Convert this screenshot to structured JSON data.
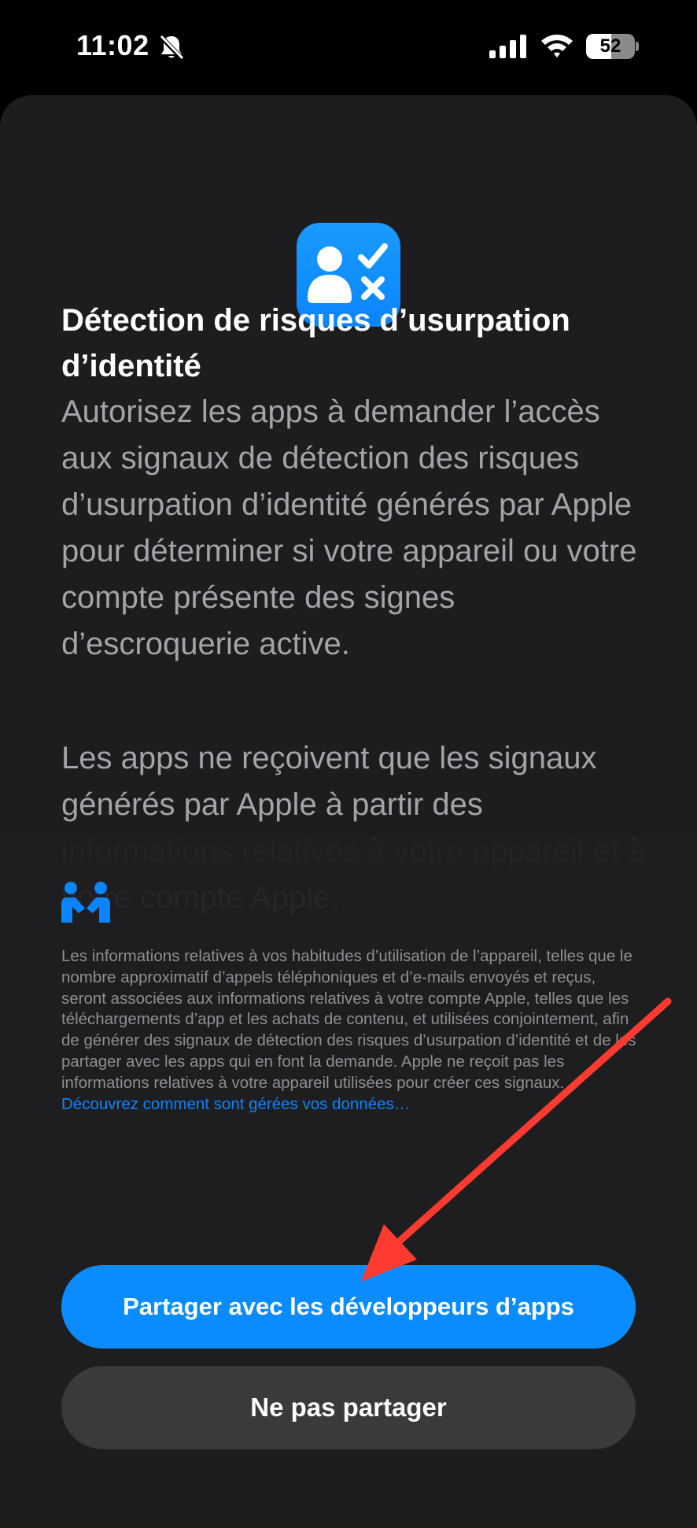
{
  "status_bar": {
    "time": "11:02",
    "battery_percent": "52",
    "icons": [
      "bell-slash-icon",
      "cellular-signal-icon",
      "wifi-icon",
      "battery-icon"
    ]
  },
  "sheet": {
    "app_icon": "person-check-x-icon",
    "title": "Détection de risques d’usurpation d’identité",
    "paragraph_1": "Autorisez les apps à demander l’accès aux signaux de détection des risques d’usurpation d’identité générés par Apple pour déterminer si votre appareil ou votre compte présente des signes d’escroquerie active.",
    "paragraph_2": "Les apps ne reçoivent que les signaux générés par Apple à partir des informations relatives à votre appareil et à votre compte Apple."
  },
  "privacy": {
    "icon": "privacy-handshake-icon",
    "text": "Les informations relatives à vos habitudes d’utilisation de l’appareil, telles que le nombre approximatif d’appels téléphoniques et d’e-mails envoyés et reçus, seront associées aux informations relatives à votre compte Apple, telles que les téléchargements d’app et les achats de contenu, et utilisées conjointement, afin de générer des signaux de détection des risques d’usurpation d’identité et de les partager avec les apps qui en font la demande. Apple ne reçoit pas les informations relatives à votre appareil utilisées pour créer ces signaux.",
    "link": "Découvrez comment sont gérées vos données…"
  },
  "buttons": {
    "share_label": "Partager avec les développeurs d’apps",
    "dont_share_label": "Ne pas partager"
  },
  "colors": {
    "accent": "#0A84FF",
    "annotation_arrow": "#FF3B30",
    "sheet_background": "#1D1D1F",
    "secondary_button": "#3A3A3C"
  }
}
